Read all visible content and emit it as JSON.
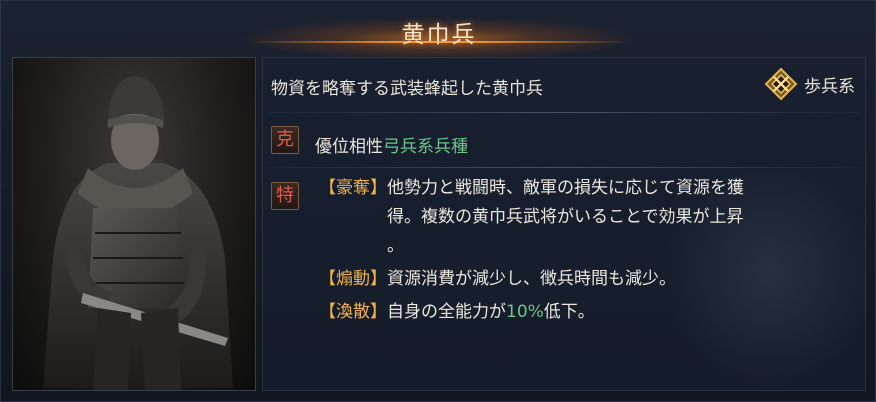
{
  "title": "黄巾兵",
  "description": "物資を略奪する武装蜂起した黄巾兵",
  "unit_type": {
    "label": "歩兵系",
    "icon": "infantry-emblem-icon"
  },
  "affinity": {
    "badge": "克",
    "label": "優位相性",
    "value": "弓兵系兵種"
  },
  "special_badge": "特",
  "traits": [
    {
      "tag": "【豪奪】",
      "lines": [
        "他勢力と戦闘時、敵軍の損失に応じて資源を獲",
        "得。複数の黄巾兵武将がいることで効果が上昇",
        "。"
      ]
    },
    {
      "tag": "【煽動】",
      "lines": [
        "資源消費が減少し、徴兵時間も減少。"
      ]
    },
    {
      "tag": "【渙散】",
      "text_before": "自身の全能力が",
      "highlight": "10%",
      "text_after": "低下。"
    }
  ],
  "colors": {
    "accent_orange": "#f1b24b",
    "highlight_green": "#6fc48a",
    "badge_red": "#e2584a",
    "title_glow": "#ff9a3a"
  }
}
